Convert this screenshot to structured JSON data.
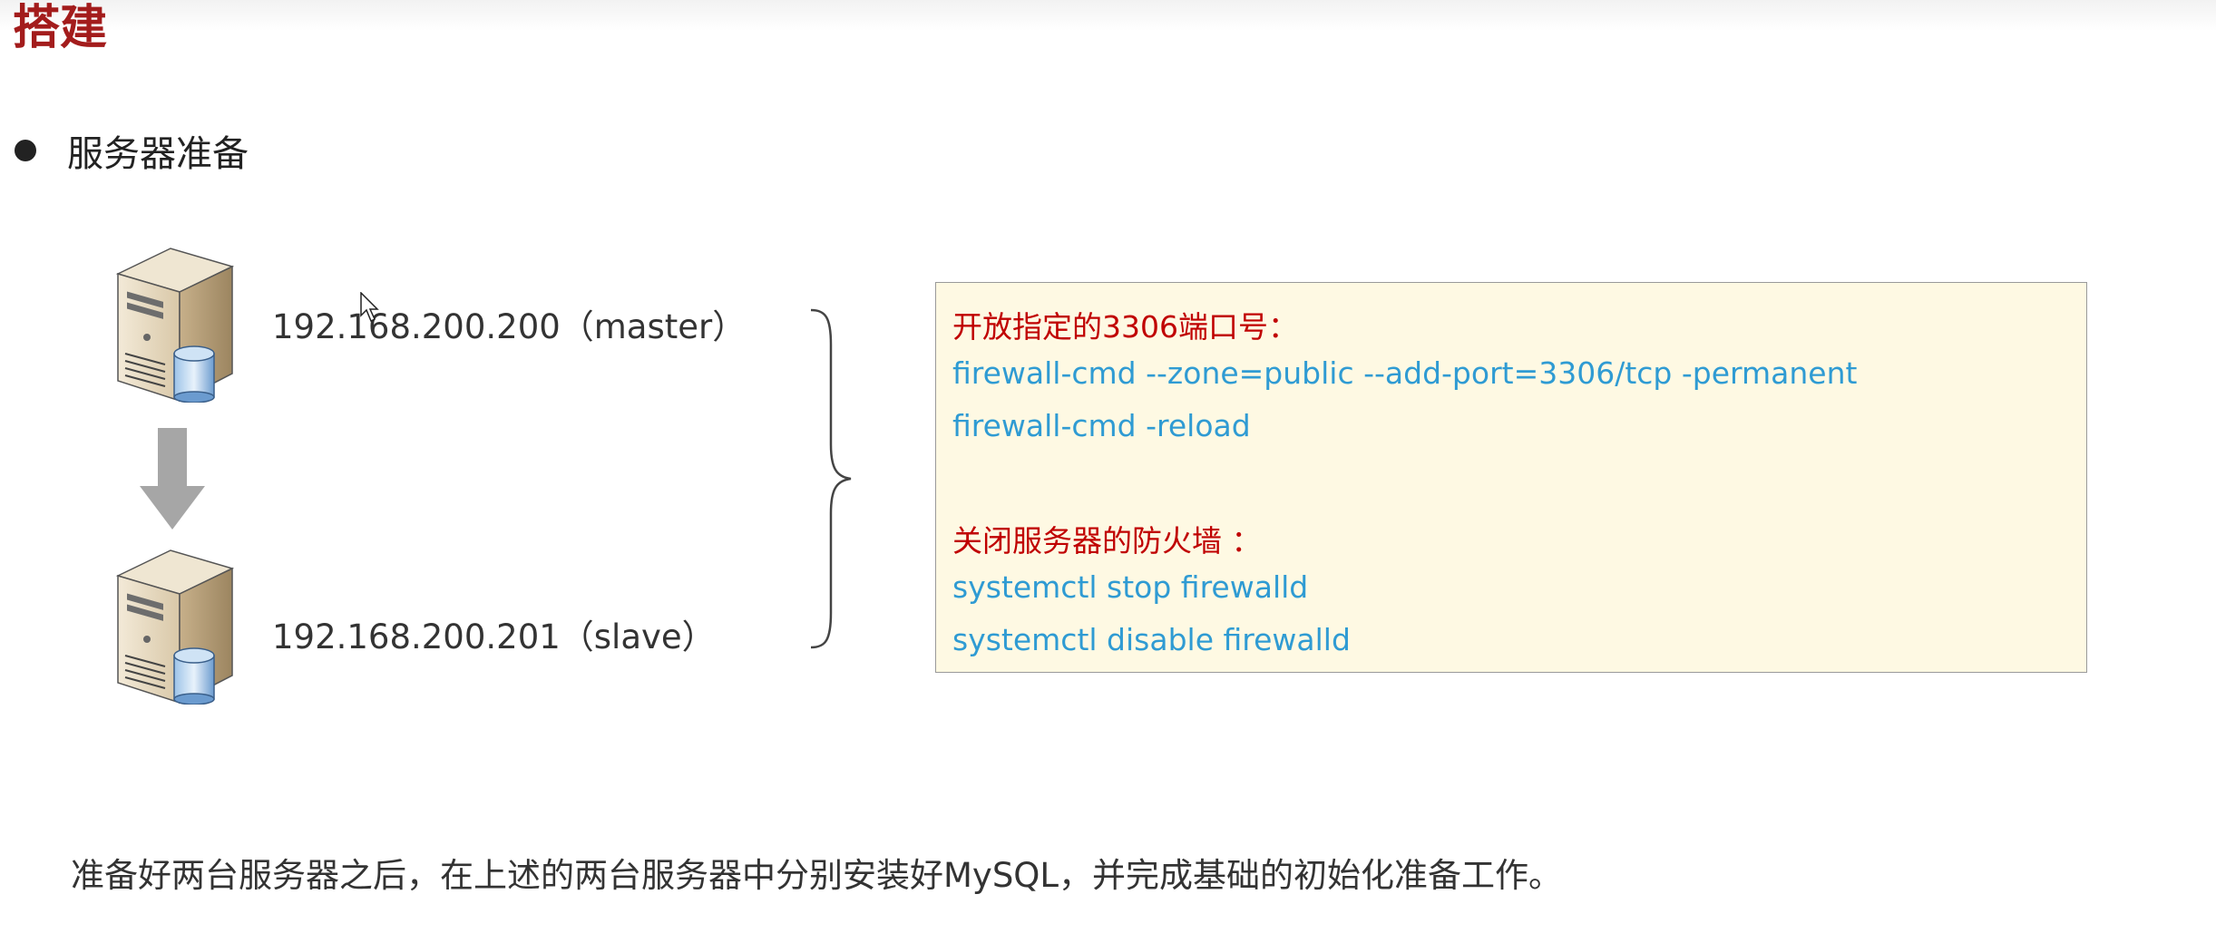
{
  "title": "搭建",
  "section": {
    "bullet_text": "服务器准备"
  },
  "servers": [
    {
      "label": "192.168.200.200（master）",
      "icon": "database-server-icon"
    },
    {
      "label": "192.168.200.201（slave）",
      "icon": "database-server-icon"
    }
  ],
  "commands": {
    "open_port_heading": "开放指定的3306端口号：",
    "open_port_cmd": "firewall-cmd --zone=public --add-port=3306/tcp -permanent",
    "reload_cmd": "firewall-cmd -reload",
    "close_firewall_heading": "关闭服务器的防火墙 ：",
    "stop_cmd": "systemctl  stop  firewalld",
    "disable_cmd": "systemctl  disable  firewalld"
  },
  "footer_note": "准备好两台服务器之后，在上述的两台服务器中分别安装好MySQL，并完成基础的初始化准备工作。",
  "colors": {
    "title": "#a31c1c",
    "command_heading": "#c00000",
    "command_code": "#2f9bd3",
    "box_background": "#fef9e3",
    "arrow": "#a6a6a6"
  }
}
